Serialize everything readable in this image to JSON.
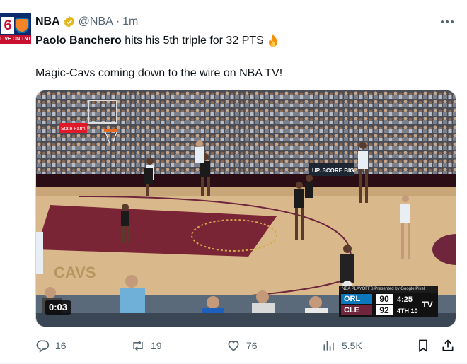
{
  "post": {
    "author_name": "NBA",
    "handle": "@NBA",
    "separator": "·",
    "time": "1m",
    "text_player": "Paolo Banchero",
    "text_line1_rest": " hits his 5th triple for 32 PTS",
    "text_line2": "Magic-Cavs coming down to the wire on NBA TV!"
  },
  "avatar": {
    "number": "6",
    "banner": "LIVE ON TNT"
  },
  "video": {
    "timer": "0:03",
    "court_text": "CAVS",
    "signage": "UP. SCORE BIG.",
    "sponsor": "State Farm",
    "scoreboard": {
      "header": "NBA PLAYOFFS  Presented by Google Pixel",
      "team1": "ORL",
      "score1": "90",
      "team2": "CLE",
      "score2": "92",
      "clock": "4:25",
      "period": "4TH  10",
      "network": "TV"
    }
  },
  "actions": {
    "replies": "16",
    "reposts": "19",
    "likes": "76",
    "views": "5.5K"
  },
  "colors": {
    "text": "#0f1419",
    "secondary": "#536471",
    "verified": "#e2b719",
    "orl_blue": "#0b77bd",
    "cle_wine": "#6f263d"
  },
  "icons": [
    "verified-badge-icon",
    "fire-emoji-icon",
    "more-options-icon",
    "reply-icon",
    "repost-icon",
    "like-icon",
    "views-icon",
    "bookmark-icon",
    "share-icon"
  ]
}
